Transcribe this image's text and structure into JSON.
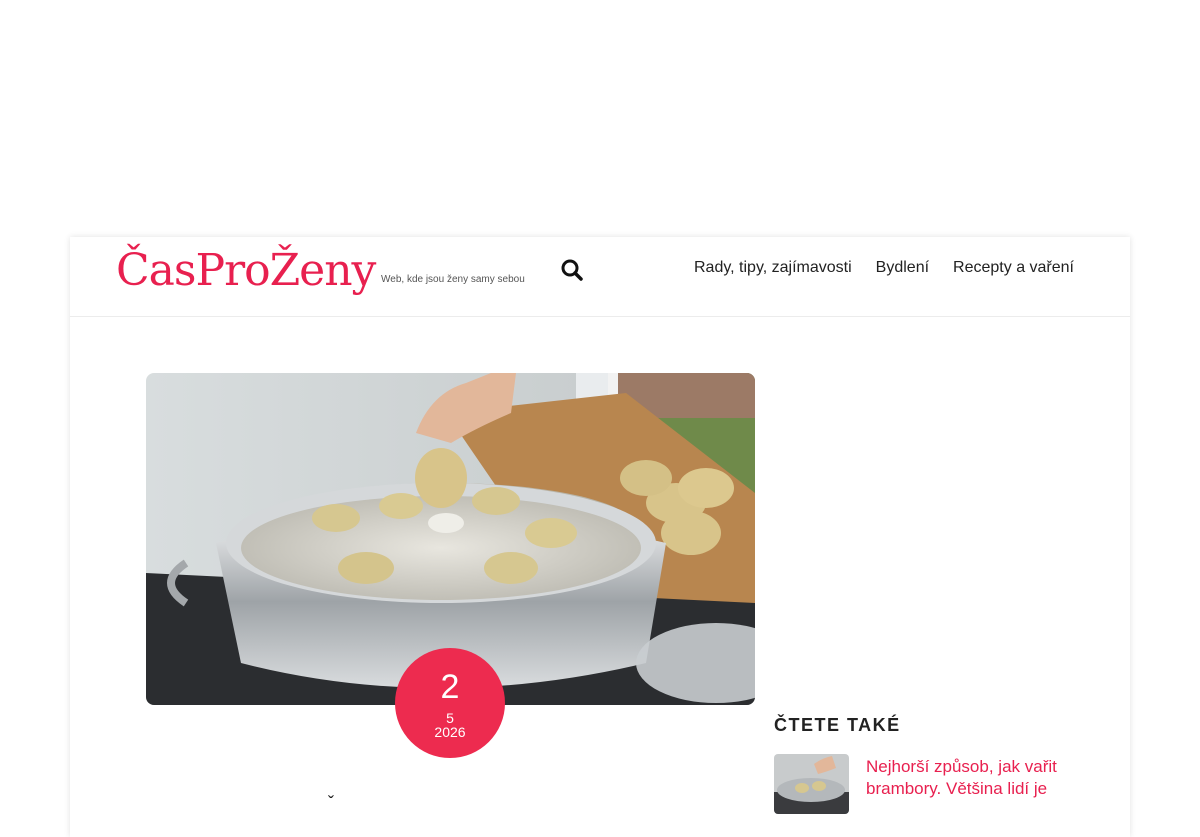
{
  "header": {
    "logo_text": "ČasProŽeny",
    "tagline": "Web, kde jsou ženy samy sebou",
    "nav": [
      {
        "label": "Rady, tipy, zajímavosti"
      },
      {
        "label": "Bydlení"
      },
      {
        "label": "Recepty a vaření"
      }
    ]
  },
  "article": {
    "date": {
      "day": "2",
      "month": "5",
      "year": "2026"
    },
    "title_peek": "ˇ"
  },
  "sidebar": {
    "heading": "ČTETE TAKÉ",
    "items": [
      {
        "title": "Nejhorší způsob, jak vařit brambory. Většina lidí je"
      }
    ]
  },
  "colors": {
    "accent": "#e8204f",
    "badge": "#ed2b4f"
  }
}
